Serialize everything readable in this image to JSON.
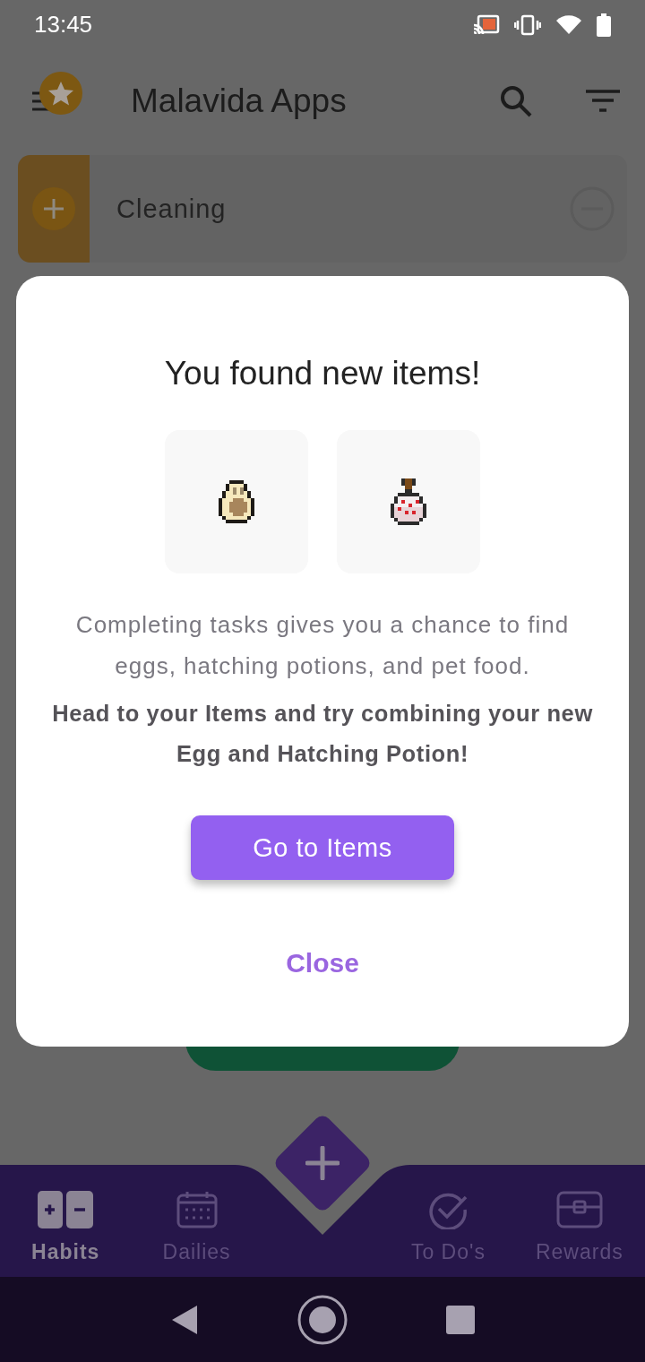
{
  "status_bar": {
    "time": "13:45"
  },
  "app_bar": {
    "title": "Malavida Apps"
  },
  "habits": [
    {
      "title": "Cleaning"
    }
  ],
  "dialog": {
    "title": "You found new items!",
    "items": [
      {
        "kind": "egg"
      },
      {
        "kind": "potion"
      }
    ],
    "description": "Completing tasks gives you a chance to find eggs, hatching potions, and pet food.",
    "hint": "Head to your Items and try combining your new Egg and Hatching Potion!",
    "primary_button": "Go to Items",
    "close_button": "Close"
  },
  "bottom_nav": {
    "tabs": [
      {
        "kind": "habits",
        "label": "Habits",
        "selected": true
      },
      {
        "kind": "dailies",
        "label": "Dailies",
        "selected": false
      },
      {
        "kind": "add"
      },
      {
        "kind": "todos",
        "label": "To Do's",
        "selected": false
      },
      {
        "kind": "rewards",
        "label": "Rewards",
        "selected": false
      }
    ]
  }
}
